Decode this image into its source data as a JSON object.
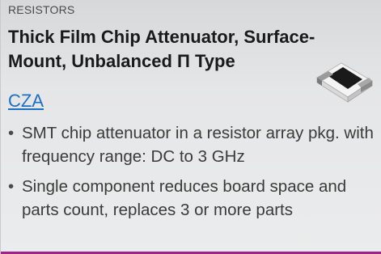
{
  "product": {
    "category": "RESISTORS",
    "title": "Thick Film Chip Attenuator, Surface-Mount, Unbalanced  Π Type",
    "code": "CZA",
    "image_icon": "chip-attenuator-icon",
    "bullets": [
      "SMT chip attenuator in a resistor array pkg. with frequency range: DC to 3 GHz",
      "Single component reduces board space and parts count, replaces 3 or more parts"
    ]
  },
  "colors": {
    "link": "#1e6fc0",
    "accent_bar": "#a3218e",
    "background": "#e5e6e7"
  }
}
